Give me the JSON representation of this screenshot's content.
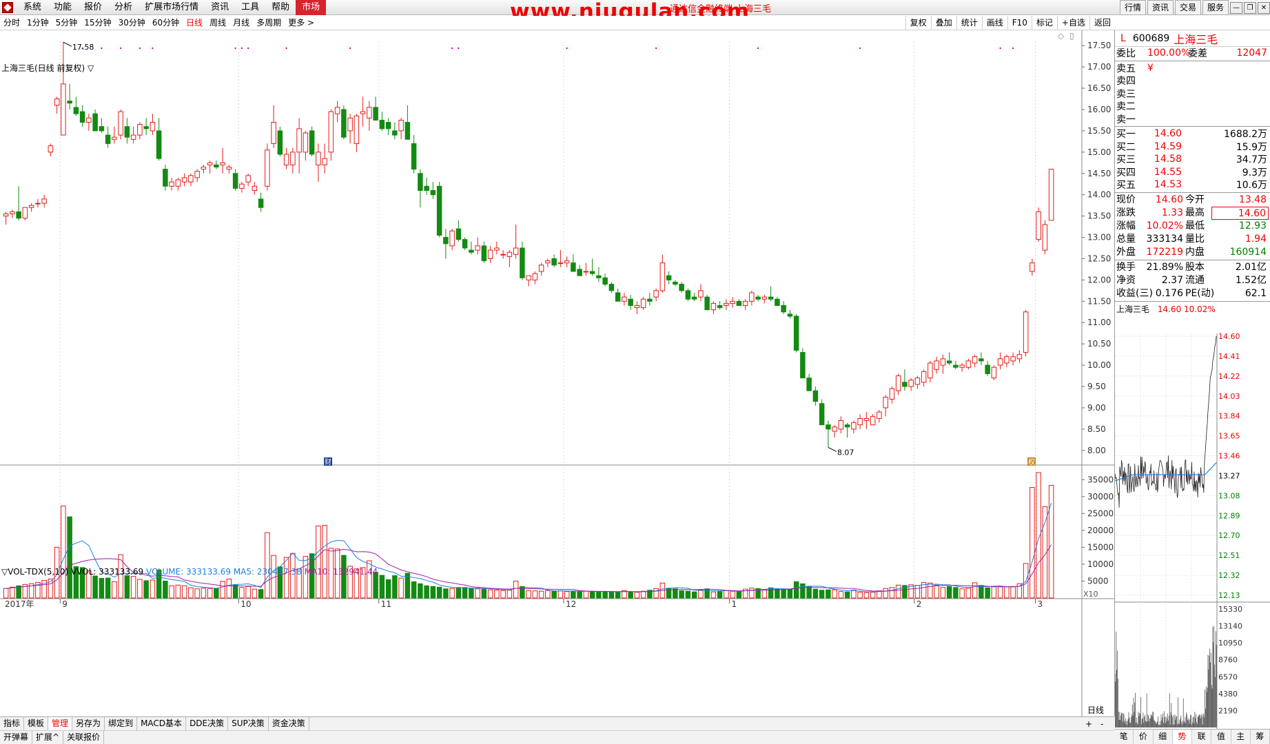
{
  "menu": {
    "items": [
      "系统",
      "功能",
      "报价",
      "分析",
      "扩展市场行情",
      "资讯",
      "工具",
      "帮助",
      "市场"
    ],
    "active": "市场",
    "watermark": "www.niugulan.com",
    "watermark_sub": "通达信金融终端 上海三毛",
    "right_buttons": [
      "行情",
      "资讯",
      "交易",
      "服务"
    ]
  },
  "periods": {
    "items": [
      "分时",
      "1分钟",
      "5分钟",
      "15分钟",
      "30分钟",
      "60分钟",
      "日线",
      "周线",
      "月线",
      "多周期",
      "更多 >"
    ],
    "active": "日线"
  },
  "right_tools": [
    "复权",
    "叠加",
    "统计",
    "画线",
    "F10",
    "标记",
    "+自选",
    "返回"
  ],
  "kline": {
    "title": "上海三毛(日线 前复权) ▽",
    "y_labels": [
      "17.50",
      "17.00",
      "16.50",
      "16.00",
      "15.50",
      "15.00",
      "14.50",
      "14.00",
      "13.50",
      "13.00",
      "12.50",
      "12.00",
      "11.50",
      "11.00",
      "10.50",
      "10.00",
      "9.50",
      "9.00",
      "8.50",
      "8.00"
    ],
    "ylim": [
      7.9,
      17.6
    ],
    "high_marker": "17.58",
    "low_marker": "8.07",
    "month_labels": [
      {
        "text": "2017年",
        "i": 0
      },
      {
        "text": "9",
        "i": 9
      },
      {
        "text": "10",
        "i": 37
      },
      {
        "text": "11",
        "i": 59
      },
      {
        "text": "12",
        "i": 88
      },
      {
        "text": "1",
        "i": 114
      },
      {
        "text": "2",
        "i": 143
      },
      {
        "text": "3",
        "i": 162
      }
    ],
    "badge_cai": "财",
    "badge_quan": "权"
  },
  "volume": {
    "title_prefix": "▽VOL-TDX(5,10) VVOL: 333133.69",
    "volume_label": "VOLUME: 333133.69",
    "ma5_label": "MA5: 230417.38",
    "ma10_label": "MA10: 132941.44",
    "y_labels": [
      "35000",
      "30000",
      "25000",
      "20000",
      "15000",
      "10000",
      "5000"
    ],
    "ymax": 37500,
    "unit": "X10"
  },
  "chart_data": {
    "type": "candlestick",
    "ohlc": [
      [
        13.5,
        13.6,
        13.3,
        13.55
      ],
      [
        13.55,
        13.65,
        13.45,
        13.6
      ],
      [
        13.6,
        14.2,
        13.4,
        13.45
      ],
      [
        13.45,
        13.7,
        13.4,
        13.7
      ],
      [
        13.7,
        13.8,
        13.6,
        13.75
      ],
      [
        13.8,
        13.9,
        13.7,
        13.8
      ],
      [
        13.8,
        14.0,
        13.7,
        13.9
      ],
      [
        15.0,
        15.2,
        14.9,
        15.15
      ],
      [
        16.1,
        16.3,
        15.9,
        16.25
      ],
      [
        15.4,
        17.58,
        15.4,
        16.6
      ],
      [
        16.2,
        16.6,
        16.0,
        16.15
      ],
      [
        16.05,
        16.3,
        15.85,
        15.9
      ],
      [
        15.95,
        16.1,
        15.6,
        15.7
      ],
      [
        15.7,
        15.9,
        15.5,
        15.8
      ],
      [
        15.9,
        16.0,
        15.5,
        15.5
      ],
      [
        15.6,
        15.8,
        15.45,
        15.5
      ],
      [
        15.4,
        15.6,
        15.1,
        15.2
      ],
      [
        15.3,
        15.6,
        15.2,
        15.35
      ],
      [
        15.4,
        16.0,
        15.3,
        15.95
      ],
      [
        15.6,
        15.8,
        15.2,
        15.35
      ],
      [
        15.3,
        15.6,
        15.2,
        15.4
      ],
      [
        15.4,
        15.7,
        15.3,
        15.65
      ],
      [
        15.6,
        15.8,
        15.4,
        15.55
      ],
      [
        15.5,
        15.9,
        15.4,
        15.7
      ],
      [
        15.5,
        15.8,
        14.8,
        14.85
      ],
      [
        14.6,
        14.7,
        14.1,
        14.2
      ],
      [
        14.2,
        14.4,
        14.1,
        14.3
      ],
      [
        14.2,
        14.4,
        14.1,
        14.35
      ],
      [
        14.3,
        14.5,
        14.2,
        14.4
      ],
      [
        14.3,
        14.5,
        14.2,
        14.45
      ],
      [
        14.4,
        14.6,
        14.3,
        14.55
      ],
      [
        14.6,
        14.7,
        14.5,
        14.65
      ],
      [
        14.7,
        14.8,
        14.5,
        14.75
      ],
      [
        14.7,
        14.8,
        14.6,
        14.65
      ],
      [
        14.7,
        15.1,
        14.5,
        14.75
      ],
      [
        14.6,
        14.7,
        14.5,
        14.65
      ],
      [
        14.5,
        14.6,
        14.1,
        14.15
      ],
      [
        14.15,
        14.3,
        14.05,
        14.25
      ],
      [
        14.3,
        14.5,
        14.2,
        14.45
      ],
      [
        14.1,
        14.3,
        14.0,
        14.2
      ],
      [
        13.9,
        14.05,
        13.6,
        13.7
      ],
      [
        14.2,
        15.2,
        14.1,
        15.05
      ],
      [
        15.2,
        16.1,
        15.1,
        15.7
      ],
      [
        15.5,
        15.6,
        14.9,
        14.95
      ],
      [
        14.7,
        15.1,
        14.6,
        14.95
      ],
      [
        14.7,
        15.1,
        14.5,
        15.0
      ],
      [
        15.0,
        15.8,
        14.5,
        15.55
      ],
      [
        15.0,
        15.5,
        14.8,
        15.45
      ],
      [
        15.5,
        15.6,
        14.9,
        14.95
      ],
      [
        14.7,
        15.2,
        14.3,
        15.0
      ],
      [
        14.7,
        15.2,
        14.5,
        14.85
      ],
      [
        15.0,
        16.0,
        14.8,
        15.95
      ],
      [
        15.9,
        16.2,
        15.7,
        16.05
      ],
      [
        16.0,
        16.1,
        15.3,
        15.35
      ],
      [
        15.5,
        15.9,
        15.2,
        15.8
      ],
      [
        15.2,
        15.9,
        15.0,
        15.85
      ],
      [
        15.9,
        16.3,
        15.6,
        15.95
      ],
      [
        15.8,
        16.2,
        15.5,
        16.05
      ],
      [
        16.05,
        16.3,
        15.8,
        15.75
      ],
      [
        15.75,
        15.95,
        15.5,
        15.55
      ],
      [
        15.7,
        15.8,
        15.4,
        15.55
      ],
      [
        15.5,
        15.7,
        15.3,
        15.4
      ],
      [
        15.5,
        15.8,
        15.3,
        15.75
      ],
      [
        15.7,
        16.1,
        15.4,
        15.3
      ],
      [
        15.2,
        15.4,
        14.5,
        14.6
      ],
      [
        14.5,
        14.6,
        13.7,
        14.1
      ],
      [
        14.2,
        14.4,
        14.0,
        14.1
      ],
      [
        14.1,
        14.3,
        13.9,
        14.0
      ],
      [
        14.2,
        14.3,
        13.0,
        13.05
      ],
      [
        13.0,
        13.2,
        12.5,
        12.85
      ],
      [
        12.8,
        13.2,
        12.7,
        13.15
      ],
      [
        13.2,
        13.4,
        12.9,
        12.95
      ],
      [
        12.95,
        13.0,
        12.7,
        12.75
      ],
      [
        12.7,
        12.9,
        12.6,
        12.65
      ],
      [
        12.7,
        13.0,
        12.6,
        12.8
      ],
      [
        12.8,
        12.9,
        12.4,
        12.45
      ],
      [
        12.5,
        12.8,
        12.4,
        12.7
      ],
      [
        12.7,
        12.9,
        12.6,
        12.75
      ],
      [
        12.6,
        12.7,
        12.5,
        12.6
      ],
      [
        12.55,
        12.7,
        12.3,
        12.65
      ],
      [
        12.6,
        13.3,
        12.5,
        12.75
      ],
      [
        12.75,
        12.9,
        12.0,
        12.05
      ],
      [
        12.0,
        12.1,
        11.85,
        12.1
      ],
      [
        12.0,
        12.2,
        11.9,
        12.15
      ],
      [
        12.2,
        12.4,
        12.1,
        12.35
      ],
      [
        12.4,
        12.5,
        12.3,
        12.45
      ],
      [
        12.5,
        12.6,
        12.3,
        12.35
      ],
      [
        12.4,
        12.7,
        12.3,
        12.4
      ],
      [
        12.4,
        12.55,
        12.3,
        12.45
      ],
      [
        12.4,
        12.6,
        12.2,
        12.2
      ],
      [
        12.25,
        12.35,
        12.1,
        12.1
      ],
      [
        12.2,
        12.4,
        12.1,
        12.2
      ],
      [
        12.2,
        12.5,
        12.1,
        12.15
      ],
      [
        12.1,
        12.3,
        11.95,
        12.05
      ],
      [
        12.05,
        12.15,
        11.85,
        11.9
      ],
      [
        11.9,
        11.95,
        11.7,
        11.75
      ],
      [
        11.7,
        11.8,
        11.5,
        11.5
      ],
      [
        11.5,
        11.7,
        11.4,
        11.6
      ],
      [
        11.55,
        11.65,
        11.3,
        11.4
      ],
      [
        11.35,
        11.5,
        11.2,
        11.4
      ],
      [
        11.35,
        11.6,
        11.3,
        11.55
      ],
      [
        11.55,
        11.7,
        11.4,
        11.5
      ],
      [
        11.6,
        11.8,
        11.5,
        11.75
      ],
      [
        11.75,
        12.6,
        11.7,
        12.4
      ],
      [
        12.1,
        12.2,
        11.9,
        12.0
      ],
      [
        11.95,
        12.0,
        11.85,
        11.9
      ],
      [
        11.9,
        11.95,
        11.7,
        11.75
      ],
      [
        11.75,
        11.8,
        11.5,
        11.55
      ],
      [
        11.6,
        11.7,
        11.5,
        11.55
      ],
      [
        11.6,
        11.9,
        11.5,
        11.75
      ],
      [
        11.6,
        11.65,
        11.3,
        11.3
      ],
      [
        11.3,
        11.5,
        11.2,
        11.45
      ],
      [
        11.4,
        11.5,
        11.3,
        11.35
      ],
      [
        11.4,
        11.55,
        11.3,
        11.45
      ],
      [
        11.45,
        11.6,
        11.35,
        11.5
      ],
      [
        11.5,
        11.55,
        11.4,
        11.4
      ],
      [
        11.4,
        11.55,
        11.3,
        11.5
      ],
      [
        11.5,
        11.75,
        11.4,
        11.7
      ],
      [
        11.6,
        11.65,
        11.5,
        11.55
      ],
      [
        11.55,
        11.65,
        11.45,
        11.6
      ],
      [
        11.6,
        11.85,
        11.5,
        11.55
      ],
      [
        11.55,
        11.6,
        11.4,
        11.4
      ],
      [
        11.4,
        11.5,
        11.2,
        11.25
      ],
      [
        11.2,
        11.3,
        11.1,
        11.15
      ],
      [
        11.15,
        11.2,
        10.3,
        10.35
      ],
      [
        10.3,
        10.4,
        9.7,
        9.7
      ],
      [
        9.7,
        9.8,
        9.4,
        9.4
      ],
      [
        9.4,
        9.5,
        9.05,
        9.15
      ],
      [
        9.1,
        9.2,
        8.6,
        8.6
      ],
      [
        8.6,
        8.7,
        8.07,
        8.5
      ],
      [
        8.45,
        8.6,
        8.3,
        8.55
      ],
      [
        8.5,
        8.8,
        8.4,
        8.7
      ],
      [
        8.6,
        8.65,
        8.3,
        8.55
      ],
      [
        8.5,
        8.7,
        8.4,
        8.65
      ],
      [
        8.6,
        8.85,
        8.5,
        8.75
      ],
      [
        8.7,
        8.9,
        8.5,
        8.75
      ],
      [
        8.6,
        8.85,
        8.6,
        8.8
      ],
      [
        8.75,
        8.95,
        8.65,
        8.9
      ],
      [
        9.0,
        9.3,
        8.8,
        9.25
      ],
      [
        9.2,
        9.5,
        9.1,
        9.45
      ],
      [
        9.4,
        9.8,
        9.3,
        9.75
      ],
      [
        9.6,
        9.9,
        9.4,
        9.5
      ],
      [
        9.5,
        9.7,
        9.4,
        9.65
      ],
      [
        9.55,
        9.75,
        9.45,
        9.7
      ],
      [
        9.6,
        9.9,
        9.5,
        9.85
      ],
      [
        9.7,
        10.1,
        9.6,
        10.05
      ],
      [
        9.9,
        10.2,
        9.8,
        10.1
      ],
      [
        10.0,
        10.25,
        9.8,
        10.15
      ],
      [
        10.1,
        10.3,
        10.0,
        10.05
      ],
      [
        10.0,
        10.1,
        9.9,
        9.95
      ],
      [
        9.95,
        10.05,
        9.85,
        10.0
      ],
      [
        9.95,
        10.15,
        9.9,
        10.1
      ],
      [
        10.05,
        10.25,
        9.95,
        10.2
      ],
      [
        10.15,
        10.3,
        10.0,
        10.1
      ],
      [
        10.0,
        10.1,
        9.75,
        9.8
      ],
      [
        9.7,
        10.0,
        9.65,
        9.95
      ],
      [
        10.0,
        10.3,
        9.9,
        10.15
      ],
      [
        10.05,
        10.25,
        9.95,
        10.2
      ],
      [
        10.1,
        10.3,
        10.0,
        10.2
      ],
      [
        10.15,
        10.35,
        10.05,
        10.25
      ],
      [
        10.3,
        11.3,
        10.2,
        11.25
      ],
      [
        12.2,
        12.5,
        12.1,
        12.4
      ],
      [
        12.95,
        13.7,
        12.9,
        13.6
      ],
      [
        12.7,
        13.4,
        12.6,
        13.3
      ],
      [
        13.4,
        14.6,
        13.4,
        14.6
      ]
    ],
    "volume": [
      2800,
      3200,
      3600,
      4000,
      4200,
      4600,
      5200,
      5600,
      15000,
      27200,
      24000,
      9300,
      9000,
      8000,
      6500,
      5800,
      5900,
      4800,
      12800,
      6600,
      6400,
      5500,
      5100,
      5300,
      8300,
      5000,
      3600,
      3800,
      3600,
      3000,
      2700,
      2900,
      2800,
      2800,
      4900,
      5600,
      3900,
      3100,
      3400,
      2600,
      2500,
      19300,
      12600,
      9200,
      12000,
      13200,
      8600,
      12300,
      13100,
      21300,
      21500,
      14700,
      14500,
      12600,
      9400,
      8600,
      9000,
      11000,
      7600,
      6700,
      5400,
      6600,
      5900,
      7300,
      4800,
      4200,
      3600,
      3400,
      3200,
      2700,
      2800,
      3100,
      3100,
      2800,
      2700,
      2600,
      2400,
      2300,
      2200,
      2300,
      5000,
      3400,
      2200,
      2100,
      2000,
      2200,
      2000,
      2100,
      1900,
      2000,
      1900,
      2000,
      1800,
      1800,
      1900,
      1700,
      1800,
      2200,
      1800,
      1700,
      2000,
      2300,
      2800,
      4400,
      2900,
      2700,
      2100,
      2000,
      1800,
      2400,
      2700,
      1800,
      1900,
      2200,
      2000,
      1900,
      2600,
      2900,
      2800,
      2500,
      3000,
      2600,
      2600,
      2600,
      4800,
      4200,
      3300,
      2600,
      2300,
      2400,
      2400,
      1900,
      1800,
      2300,
      1700,
      1600,
      1700,
      2100,
      2800,
      3100,
      3800,
      3700,
      3900,
      3700,
      4600,
      4400,
      3800,
      3100,
      3400,
      3100,
      2700,
      2900,
      4500,
      3700,
      3000,
      3300,
      3300,
      3300,
      3400,
      4200,
      10200,
      32700,
      37100,
      27000,
      33300
    ],
    "ma5_color": "#1f7fe0",
    "ma10_color": "#a020a0",
    "up_color": "#e41b17",
    "down_color": "#138a12"
  },
  "quote": {
    "icon": "L",
    "code": "600689",
    "name": "上海三毛",
    "weibi_label": "委比",
    "weibi": "100.00%",
    "weicha_label": "委差",
    "weicha": "12047",
    "sell": [
      {
        "label": "卖五",
        "price": "¥",
        "vol": ""
      },
      {
        "label": "卖四",
        "price": "",
        "vol": ""
      },
      {
        "label": "卖三",
        "price": "",
        "vol": ""
      },
      {
        "label": "卖二",
        "price": "",
        "vol": ""
      },
      {
        "label": "卖一",
        "price": "",
        "vol": ""
      }
    ],
    "buy": [
      {
        "label": "买一",
        "price": "14.60",
        "vol": "1688.2万"
      },
      {
        "label": "买二",
        "price": "14.59",
        "vol": "15.9万"
      },
      {
        "label": "买三",
        "price": "14.58",
        "vol": "34.7万"
      },
      {
        "label": "买四",
        "price": "14.55",
        "vol": "9.3万"
      },
      {
        "label": "买五",
        "price": "14.53",
        "vol": "10.6万"
      }
    ],
    "stats": [
      [
        "现价",
        "14.60",
        "今开",
        "13.48"
      ],
      [
        "涨跌",
        "1.33",
        "最高",
        "14.60"
      ],
      [
        "涨幅",
        "10.02%",
        "最低",
        "12.93"
      ],
      [
        "总量",
        "333134",
        "量比",
        "1.94"
      ],
      [
        "外盘",
        "172219",
        "内盘",
        "160914"
      ]
    ],
    "stats2": [
      [
        "换手",
        "21.89%",
        "股本",
        "2.01亿"
      ],
      [
        "净资",
        "2.37",
        "流通",
        "1.52亿"
      ],
      [
        "收益(三)",
        "0.176",
        "PE(动)",
        "62.1"
      ]
    ]
  },
  "mini": {
    "title_name": "上海三毛",
    "title_price": "14.60",
    "title_pct": "10.02%",
    "price_labels": [
      "14.60",
      "14.41",
      "14.22",
      "14.03",
      "13.84",
      "13.65",
      "13.46",
      "13.27",
      "13.08",
      "12.89",
      "12.70",
      "12.51",
      "12.32",
      "12.13"
    ],
    "vol_labels": [
      "15330",
      "13140",
      "10950",
      "8760",
      "6570",
      "4380",
      "2190"
    ]
  },
  "bottom": {
    "tabs1": [
      "指标",
      "模板",
      "管理",
      "另存为",
      "绑定到",
      "MACD基本",
      "DDE决策",
      "SUP决策",
      "资金决策"
    ],
    "tabs1_active": "管理",
    "plus": "+",
    "minus": "-",
    "period_right": "日线",
    "tabs2": [
      "开弹幕",
      "扩展^",
      "关联报价"
    ],
    "rtabs": [
      "笔",
      "价",
      "细",
      "势",
      "联",
      "值",
      "主",
      "筹"
    ],
    "rtabs_active": "势"
  }
}
